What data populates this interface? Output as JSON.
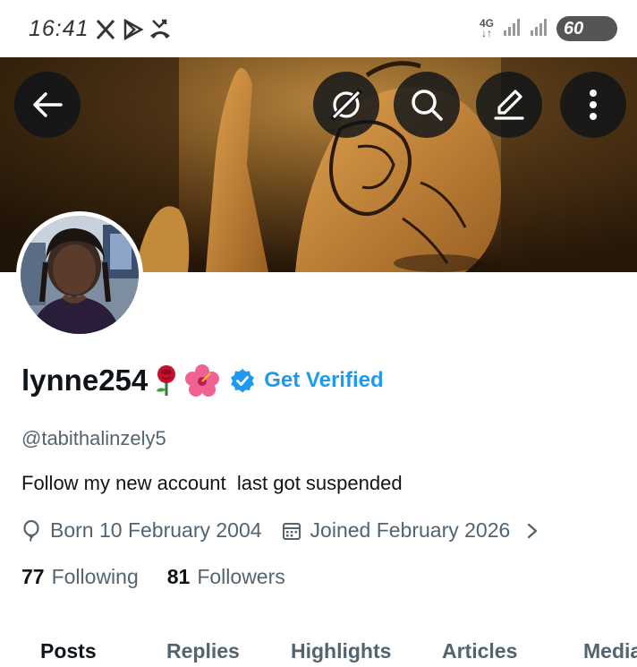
{
  "status_bar": {
    "time": "16:41",
    "network": "4G",
    "battery": "60",
    "icons": [
      "x-icon",
      "play-store-icon",
      "missed-call-icon",
      "signal-icon",
      "signal-icon",
      "battery-icon"
    ]
  },
  "header_actions": [
    "back-arrow-icon",
    "refresh-icon",
    "search-icon",
    "edit-icon",
    "more-vertical-icon"
  ],
  "profile": {
    "display_name": "lynne254",
    "name_emojis": [
      "🌹",
      "🌺"
    ],
    "get_verified": "Get Verified",
    "handle": "@tabithalinzely5",
    "bio": "Follow my new account  last got suspended",
    "born": "Born 10 February 2004",
    "joined": "Joined February 2026",
    "following_count": "77",
    "following_label": "Following",
    "followers_count": "81",
    "followers_label": "Followers"
  },
  "tabs": [
    {
      "label": "Posts",
      "active": true
    },
    {
      "label": "Replies",
      "active": false
    },
    {
      "label": "Highlights",
      "active": false
    },
    {
      "label": "Articles",
      "active": false
    },
    {
      "label": "Media",
      "active": false
    }
  ],
  "colors": {
    "accent": "#1d9bf0",
    "text_primary": "#0f1419",
    "text_secondary": "#536471",
    "rose": "#c8102e",
    "hibiscus": "#f06292"
  }
}
